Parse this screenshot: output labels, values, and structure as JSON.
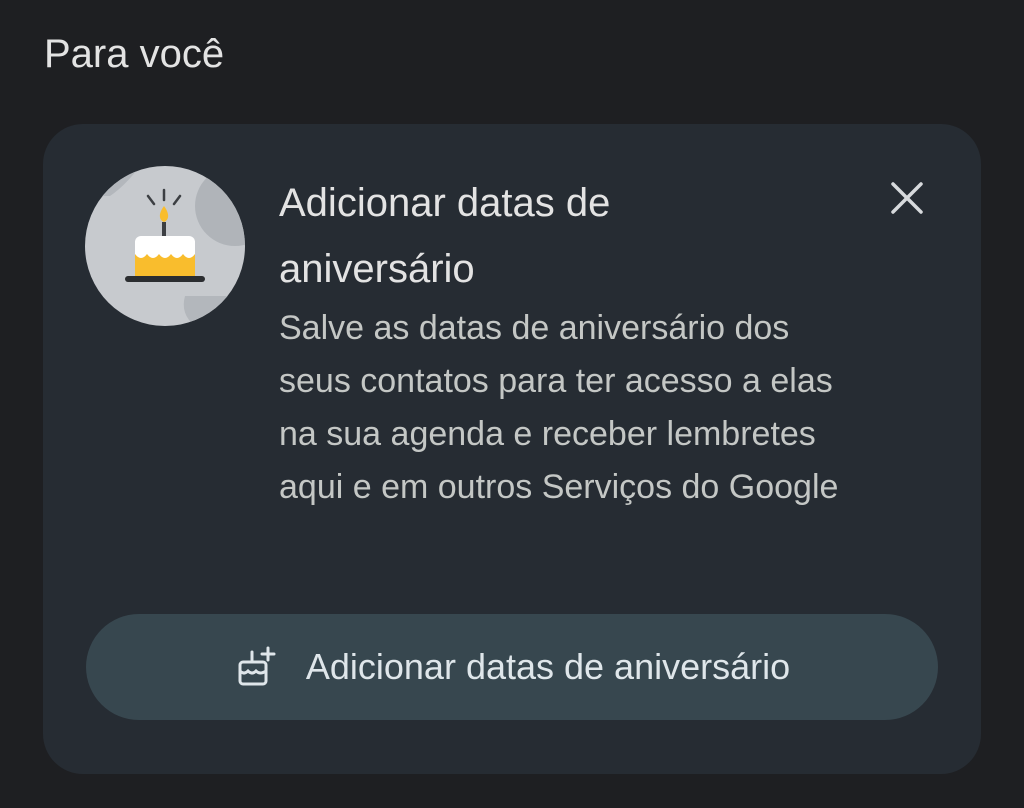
{
  "section": {
    "title": "Para você"
  },
  "card": {
    "title": "Adicionar datas de aniversário",
    "description": "Salve as datas de aniversário dos seus contatos para ter acesso a elas na sua agenda e receber lembretes aqui e em outros Serviços do Google",
    "illustration_icon": "birthday-cake-icon",
    "close_icon": "close-icon",
    "button": {
      "label": "Adicionar datas de aniversário",
      "icon": "add-cake-icon"
    }
  },
  "colors": {
    "background": "#1e1f22",
    "card": "#262c33",
    "button": "#37474f",
    "cake_yellow": "#f9bd2d",
    "candle_flame": "#f9bd2d"
  }
}
